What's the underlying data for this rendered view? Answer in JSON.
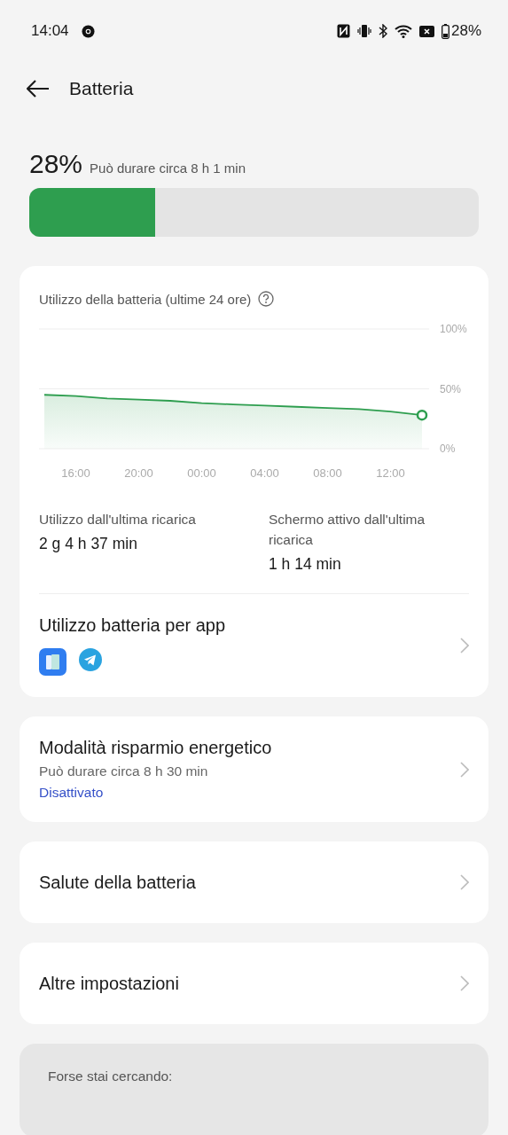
{
  "status_bar": {
    "time": "14:04",
    "battery": "28%"
  },
  "header": {
    "title": "Batteria"
  },
  "battery": {
    "percent": "28%",
    "estimate": "Può durare circa 8 h 1 min",
    "level": 0.28
  },
  "usage_card": {
    "title": "Utilizzo della batteria (ultime 24 ore)",
    "chart_data": {
      "type": "area",
      "categories": [
        null,
        "16:00",
        null,
        "20:00",
        null,
        "00:00",
        null,
        "04:00",
        null,
        "08:00",
        null,
        "12:00",
        null
      ],
      "series": [
        {
          "color": "#2e9e4f",
          "values": [
            45,
            44,
            42,
            41,
            40,
            38,
            37,
            36,
            35,
            34,
            33,
            31,
            28
          ]
        }
      ],
      "ylim": [
        0,
        100
      ],
      "yticks": [
        {
          "value": 0,
          "label": "0%"
        },
        {
          "value": 50,
          "label": "50%"
        },
        {
          "value": 100,
          "label": "100%"
        }
      ]
    },
    "stats": [
      {
        "label": "Utilizzo dall'ultima ricarica",
        "value": "2 g 4 h 37 min"
      },
      {
        "label": "Schermo attivo dall'ultima ricarica",
        "value": "1 h 14 min"
      }
    ],
    "per_app": {
      "title": "Utilizzo batteria per app"
    }
  },
  "items": [
    {
      "title": "Modalità risparmio energetico",
      "subtitle": "Può durare circa 8 h 30 min",
      "status": "Disattivato"
    },
    {
      "title": "Salute della batteria"
    },
    {
      "title": "Altre impostazioni"
    }
  ],
  "suggestions": {
    "title": "Forse stai cercando:"
  }
}
